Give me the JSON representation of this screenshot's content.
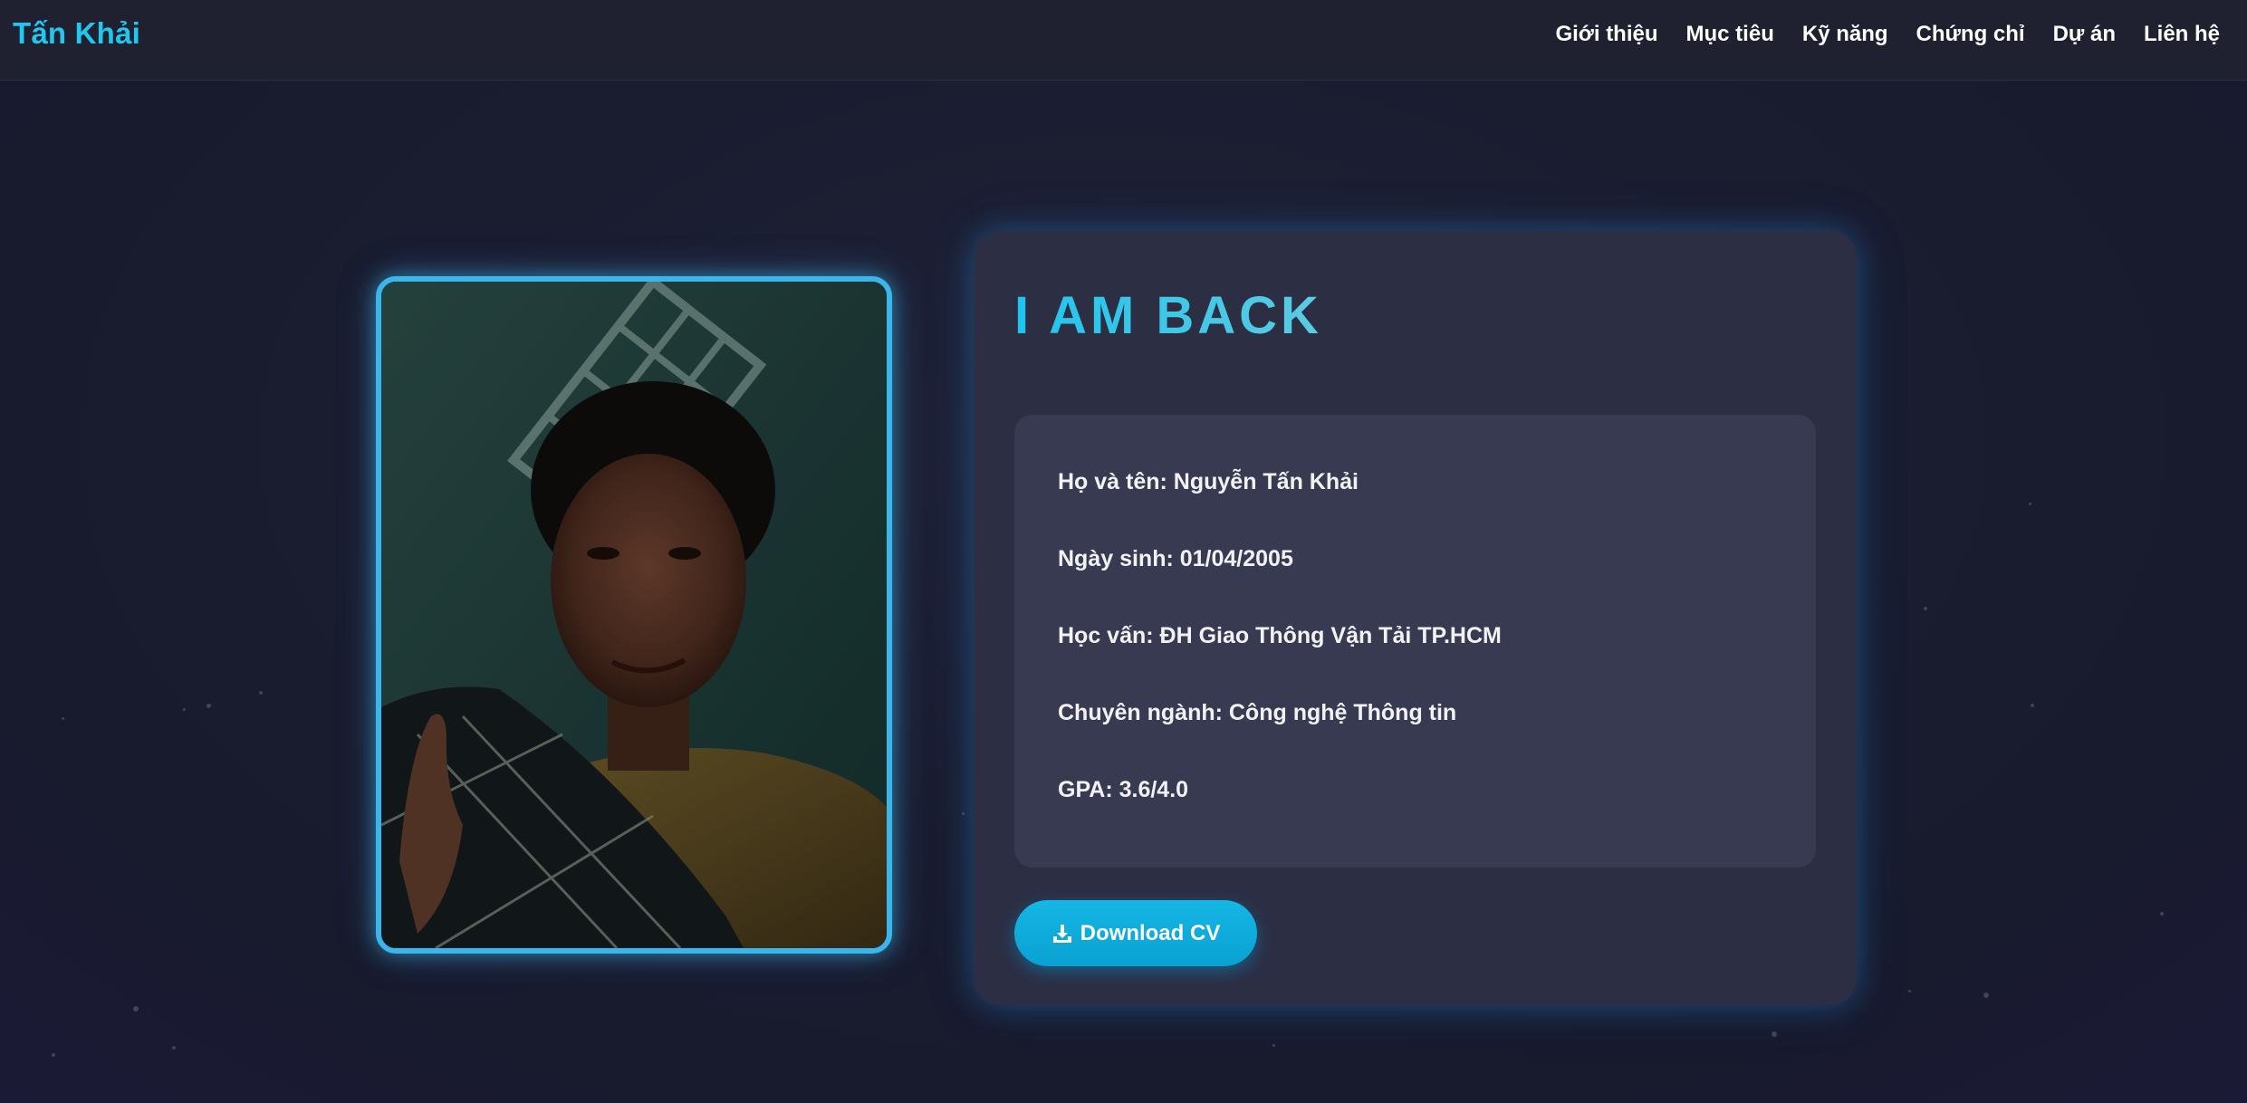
{
  "navbar": {
    "brand": "Tấn Khải",
    "links": [
      "Giới thiệu",
      "Mục tiêu",
      "Kỹ năng",
      "Chứng chỉ",
      "Dự án",
      "Liên hệ"
    ]
  },
  "hero": {
    "headline": "I AM BACK",
    "details": [
      "Họ và tên: Nguyễn Tấn Khải",
      "Ngày sinh: 01/04/2005",
      "Học vấn: ĐH Giao Thông Vận Tải TP.HCM",
      "Chuyên ngành: Công nghệ Thông tin",
      "GPA: 3.6/4.0"
    ],
    "download_label": "Download CV",
    "download_icon": "download-icon"
  },
  "colors": {
    "accent": "#22c7f0",
    "photo_border": "#3bb6ec",
    "button": "#0aa1d2",
    "card": "#2c2e44",
    "details_box": "#383a52"
  }
}
